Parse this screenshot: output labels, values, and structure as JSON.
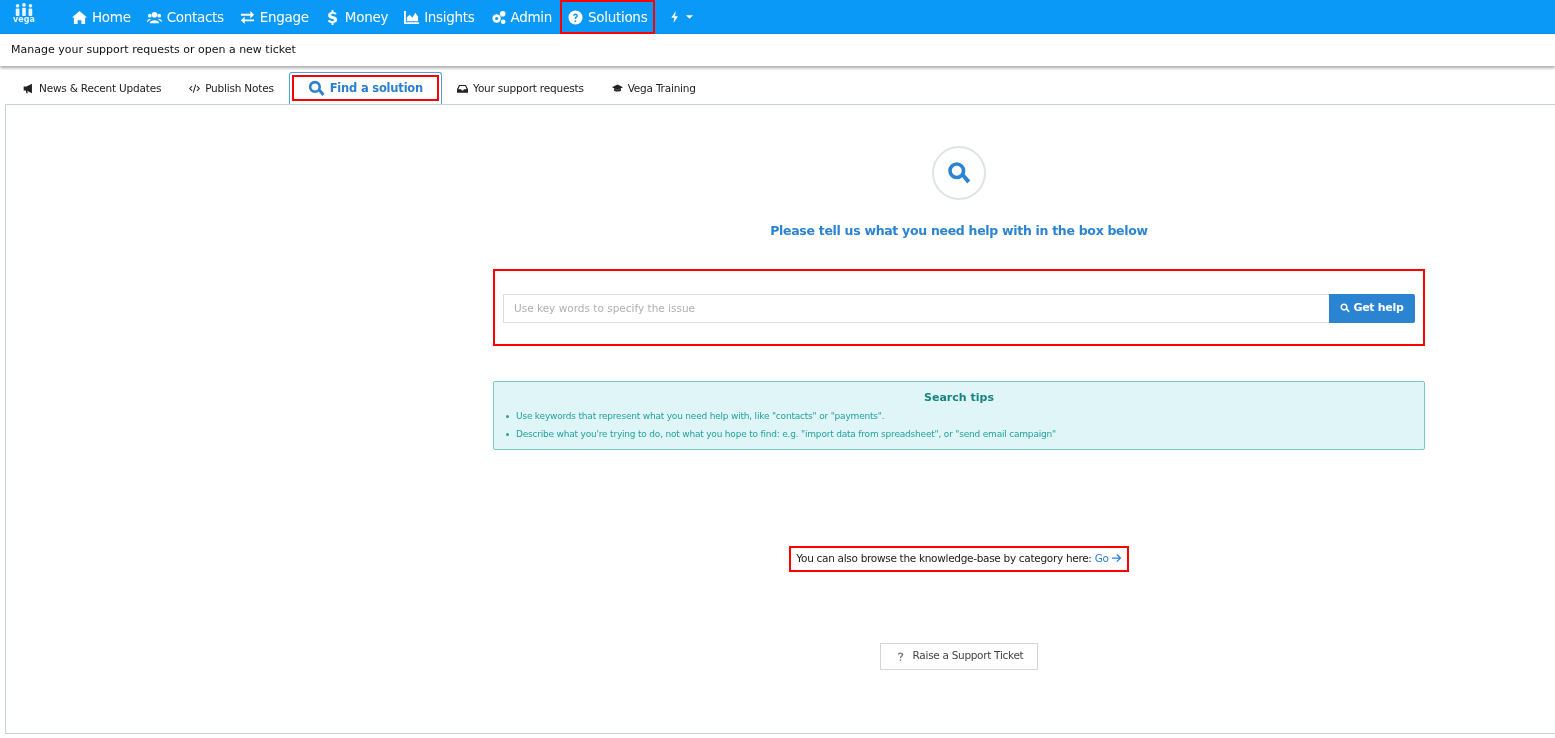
{
  "brand": {
    "logo_text": "vega"
  },
  "nav": [
    {
      "label": "Home",
      "highlighted": false
    },
    {
      "label": "Contacts",
      "highlighted": false
    },
    {
      "label": "Engage",
      "highlighted": false
    },
    {
      "label": "Money",
      "highlighted": false
    },
    {
      "label": "Insights",
      "highlighted": false
    },
    {
      "label": "Admin",
      "highlighted": false
    },
    {
      "label": "Solutions",
      "highlighted": true
    }
  ],
  "subtitle": "Manage your support requests or open a new ticket",
  "tabs": [
    {
      "label": "News & Recent Updates",
      "selected": false,
      "highlighted": false
    },
    {
      "label": "Publish Notes",
      "selected": false,
      "highlighted": false
    },
    {
      "label": "Find a solution",
      "selected": true,
      "highlighted": true
    },
    {
      "label": "Your support requests",
      "selected": false,
      "highlighted": false
    },
    {
      "label": "Vega Training",
      "selected": false,
      "highlighted": false
    }
  ],
  "prompt": "Please tell us what you need help with in the box below",
  "search": {
    "placeholder": "Use key words to specify the issue",
    "button": "Get help",
    "highlighted": true
  },
  "tips": {
    "title": "Search tips",
    "items": [
      "Use keywords that represent what you need help with, like \"contacts\" or \"payments\".",
      "Describe what you're trying to do, not what you hope to find: e.g. \"import data from spreadsheet\", or \"send email campaign\""
    ]
  },
  "browse": {
    "text": "You can also browse the knowledge-base by category here:",
    "link": "Go",
    "highlighted": true
  },
  "ticket_button": "Raise a Support Ticket"
}
